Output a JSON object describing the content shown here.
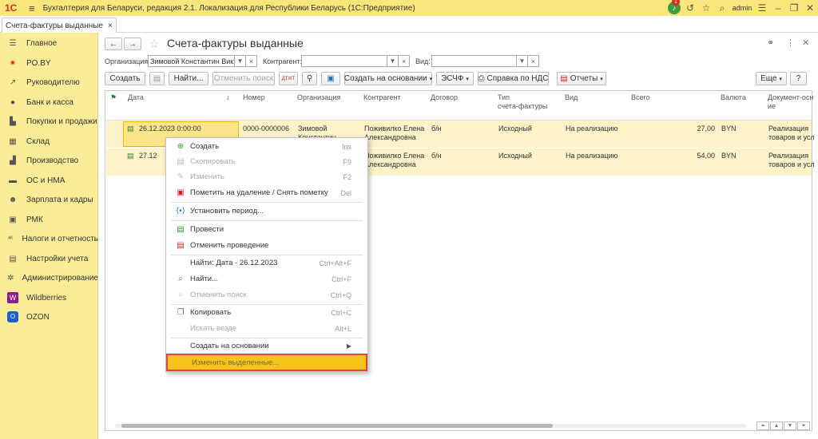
{
  "app": {
    "logo": "1С",
    "title": "Бухгалтерия для Беларуси, редакция 2.1. Локализация для Республики Беларусь   (1С:Предприятие)",
    "user": "admin",
    "notifications": "1"
  },
  "tab": {
    "label": "Счета-фактуры выданные",
    "close": "×"
  },
  "sidebar": {
    "items": [
      {
        "label": "Главное",
        "icon": "list-icon"
      },
      {
        "label": "PO.BY",
        "icon": "sun-icon"
      },
      {
        "label": "Руководителю",
        "icon": "trend-icon"
      },
      {
        "label": "Банк и касса",
        "icon": "coin-icon"
      },
      {
        "label": "Покупки и продажи",
        "icon": "cart-icon"
      },
      {
        "label": "Склад",
        "icon": "grid-icon"
      },
      {
        "label": "Производство",
        "icon": "factory-icon"
      },
      {
        "label": "ОС и НМА",
        "icon": "truck-icon"
      },
      {
        "label": "Зарплата и кадры",
        "icon": "people-icon"
      },
      {
        "label": "РМК",
        "icon": "register-icon"
      },
      {
        "label": "Налоги и отчетность",
        "icon": "tax-icon"
      },
      {
        "label": "Настройки учета",
        "icon": "book-icon"
      },
      {
        "label": "Администрирование",
        "icon": "gear-icon"
      },
      {
        "label": "Wildberries",
        "icon": "wildberries-logo"
      },
      {
        "label": "OZON",
        "icon": "ozon-logo"
      }
    ]
  },
  "form": {
    "title": "Счета-фактуры выданные",
    "filters": {
      "org_label": "Организация:",
      "org_value": "Зимовой Константин Викто",
      "contr_label": "Контрагент:",
      "contr_value": "",
      "kind_label": "Вид:",
      "kind_value": ""
    },
    "toolbar": {
      "create": "Создать",
      "find": "Найти...",
      "cancel_search": "Отменить поиск",
      "create_based": "Создать на основании",
      "esf": "ЭСЧФ",
      "vat_ref": "Справка по НДС",
      "reports": "Отчеты",
      "more": "Еще",
      "help": "?"
    }
  },
  "table": {
    "columns": [
      "Дата",
      "Номер",
      "Организация",
      "Контрагент",
      "Договор",
      "Тип\nсчета-фактуры",
      "Вид",
      "Всего",
      "Валюта",
      "Документ-осн\nие"
    ],
    "rows": [
      {
        "date": "26.12.2023 0:00:00",
        "number": "0000-0000006",
        "org": "Зимовой\nКонстантин",
        "contr": "Поживилко Елена\nАлександровна",
        "contract": "б/н",
        "type": "Исходный",
        "kind": "На реализацию",
        "total": "27,00",
        "currency": "BYN",
        "basis": "Реализация\nтоваров и усл"
      },
      {
        "date": "27.12",
        "number": "",
        "org": "",
        "contr": "Поживилко Елена\nАлександровна",
        "contract": "б/н",
        "type": "Исходный",
        "kind": "На реализацию",
        "total": "54,00",
        "currency": "BYN",
        "basis": "Реализация\nтоваров и усл"
      }
    ]
  },
  "context_menu": {
    "items": [
      {
        "label": "Создать",
        "shortcut": "Ins",
        "icon": "plus-icon",
        "disabled": false
      },
      {
        "label": "Скопировать",
        "shortcut": "F9",
        "icon": "copy-icon",
        "disabled": true
      },
      {
        "label": "Изменить",
        "shortcut": "F2",
        "icon": "pencil-icon",
        "disabled": true
      },
      {
        "label": "Пометить на удаление / Снять пометку",
        "shortcut": "Del",
        "icon": "delete-mark-icon",
        "disabled": false
      },
      {
        "label": "Установить период...",
        "shortcut": "",
        "icon": "period-icon",
        "disabled": false
      },
      {
        "label": "Провести",
        "shortcut": "",
        "icon": "post-icon",
        "disabled": false
      },
      {
        "label": "Отменить проведение",
        "shortcut": "",
        "icon": "unpost-icon",
        "disabled": false
      },
      {
        "label": "Найти: Дата - 26.12.2023",
        "shortcut": "Ctrl+Alt+F",
        "icon": "",
        "disabled": false
      },
      {
        "label": "Найти...",
        "shortcut": "Ctrl+F",
        "icon": "search-icon",
        "disabled": false
      },
      {
        "label": "Отменить поиск",
        "shortcut": "Ctrl+Q",
        "icon": "cancel-search-icon",
        "disabled": true
      },
      {
        "label": "Копировать",
        "shortcut": "Ctrl+C",
        "icon": "clipboard-icon",
        "disabled": false
      },
      {
        "label": "Искать везде",
        "shortcut": "Alt+L",
        "icon": "",
        "disabled": true
      },
      {
        "label": "Создать на основании",
        "shortcut": "",
        "icon": "",
        "disabled": false
      },
      {
        "label": "Изменить выделенные...",
        "shortcut": "",
        "icon": "",
        "disabled": true
      }
    ]
  }
}
